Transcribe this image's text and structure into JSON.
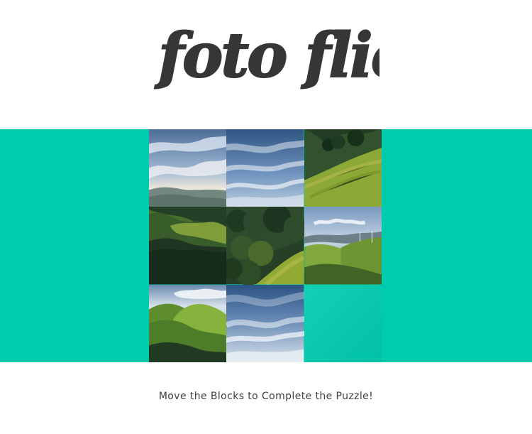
{
  "app": {
    "title": "foto flick"
  },
  "game": {
    "instruction": "Move the Blocks to Complete the Puzzle!",
    "board": {
      "rows": 3,
      "columns": 3,
      "empty_tile_index": 8
    },
    "tiles": [
      {
        "label": "sky with clouds and distant mountains"
      },
      {
        "label": "blue sky with streaky clouds"
      },
      {
        "label": "grassy hillside with trees"
      },
      {
        "label": "green hills and dark forest"
      },
      {
        "label": "forest and sunny grass slope"
      },
      {
        "label": "sky over rolling green hill"
      },
      {
        "label": "bright green hills"
      },
      {
        "label": "blue sky with clouds"
      },
      {
        "label": "empty tile"
      }
    ]
  },
  "colors": {
    "stage": "#00cbaf",
    "title": "#363636",
    "instruction": "#3d3d3d",
    "background": "#ffffff"
  }
}
